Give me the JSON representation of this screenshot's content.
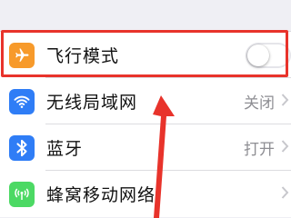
{
  "colors": {
    "airplane_icon_bg": "#f79a2b",
    "wifi_icon_bg": "#2f7df6",
    "bluetooth_icon_bg": "#2f7df6",
    "cellular_icon_bg": "#4cd964",
    "highlight": "#e8332b"
  },
  "settings": {
    "items": [
      {
        "label": "飞行模式",
        "icon": "airplane-icon",
        "toggle": false
      },
      {
        "label": "无线局域网",
        "icon": "wifi-icon",
        "value": "关闭"
      },
      {
        "label": "蓝牙",
        "icon": "bluetooth-icon",
        "value": "打开"
      },
      {
        "label": "蜂窝移动网络",
        "icon": "cellular-icon"
      }
    ]
  }
}
